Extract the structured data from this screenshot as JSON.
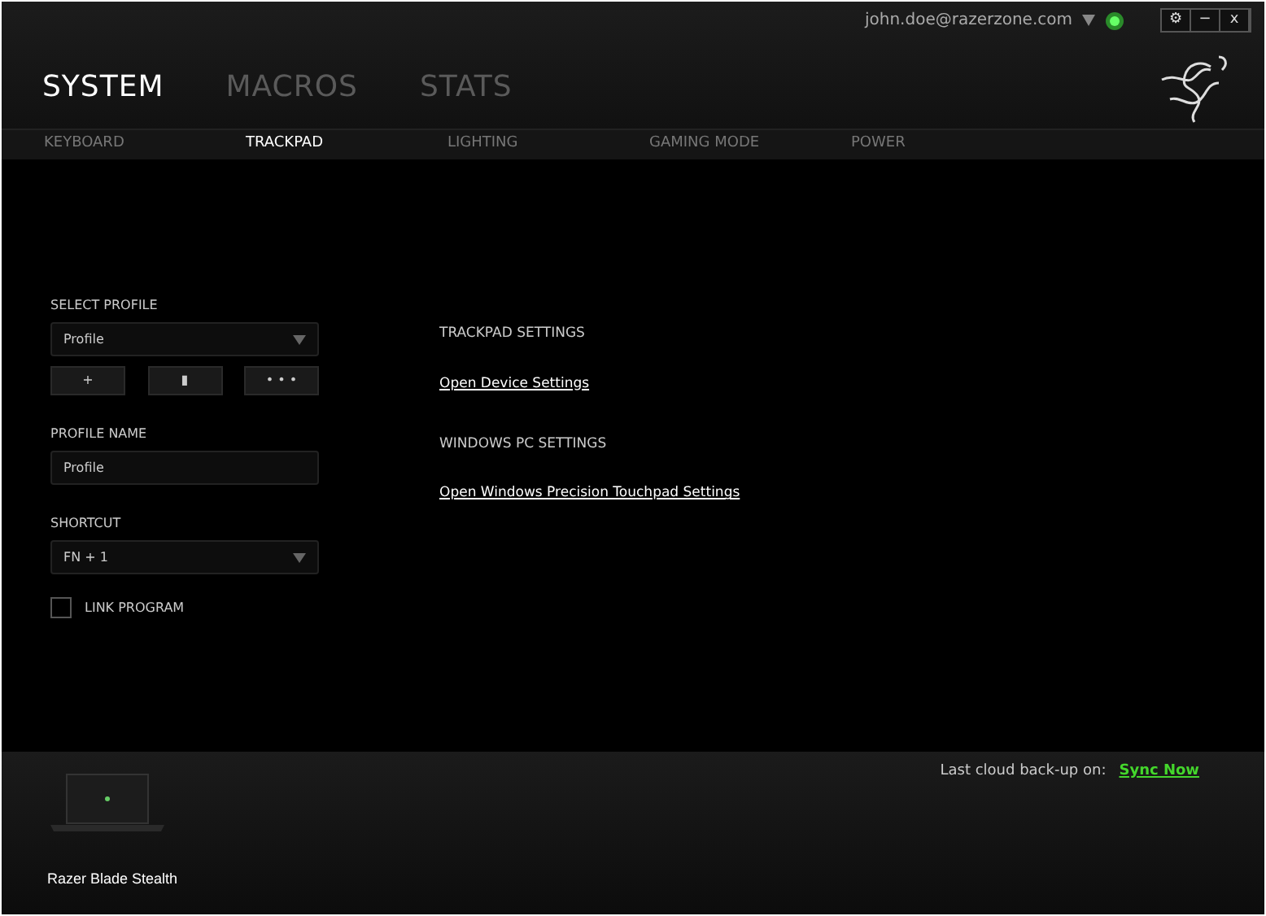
{
  "account": {
    "email": "john.doe@razerzone.com",
    "online": true
  },
  "window_controls": [
    "⚙",
    "−",
    "x"
  ],
  "main_tabs": [
    {
      "label": "SYSTEM",
      "selected": true
    },
    {
      "label": "MACROS",
      "selected": false
    },
    {
      "label": "STATS",
      "selected": false
    }
  ],
  "sub_tabs": [
    {
      "label": "KEYBOARD",
      "selected": false
    },
    {
      "label": "TRACKPAD",
      "selected": true
    },
    {
      "label": "LIGHTING",
      "selected": false
    },
    {
      "label": "GAMING MODE",
      "selected": false
    },
    {
      "label": "POWER",
      "selected": false
    }
  ],
  "profile": {
    "select_label": "SELECT PROFILE",
    "select_value": "Profile",
    "buttons": [
      "+",
      "▮",
      "• • •"
    ],
    "name_label": "PROFILE NAME",
    "name_value": "Profile",
    "shortcut_label": "SHORTCUT",
    "shortcut_value": "FN + 1",
    "link_program": {
      "label": "LINK PROGRAM",
      "checked": false
    }
  },
  "settings": [
    {
      "heading": "TRACKPAD SETTINGS",
      "link": "Open Device Settings"
    },
    {
      "heading": "WINDOWS PC SETTINGS",
      "link": "Open Windows Precision Touchpad Settings"
    }
  ],
  "footer": {
    "device": "Razer Blade Stealth",
    "backup_label": "Last cloud back-up on:",
    "sync_link": "Sync Now"
  }
}
